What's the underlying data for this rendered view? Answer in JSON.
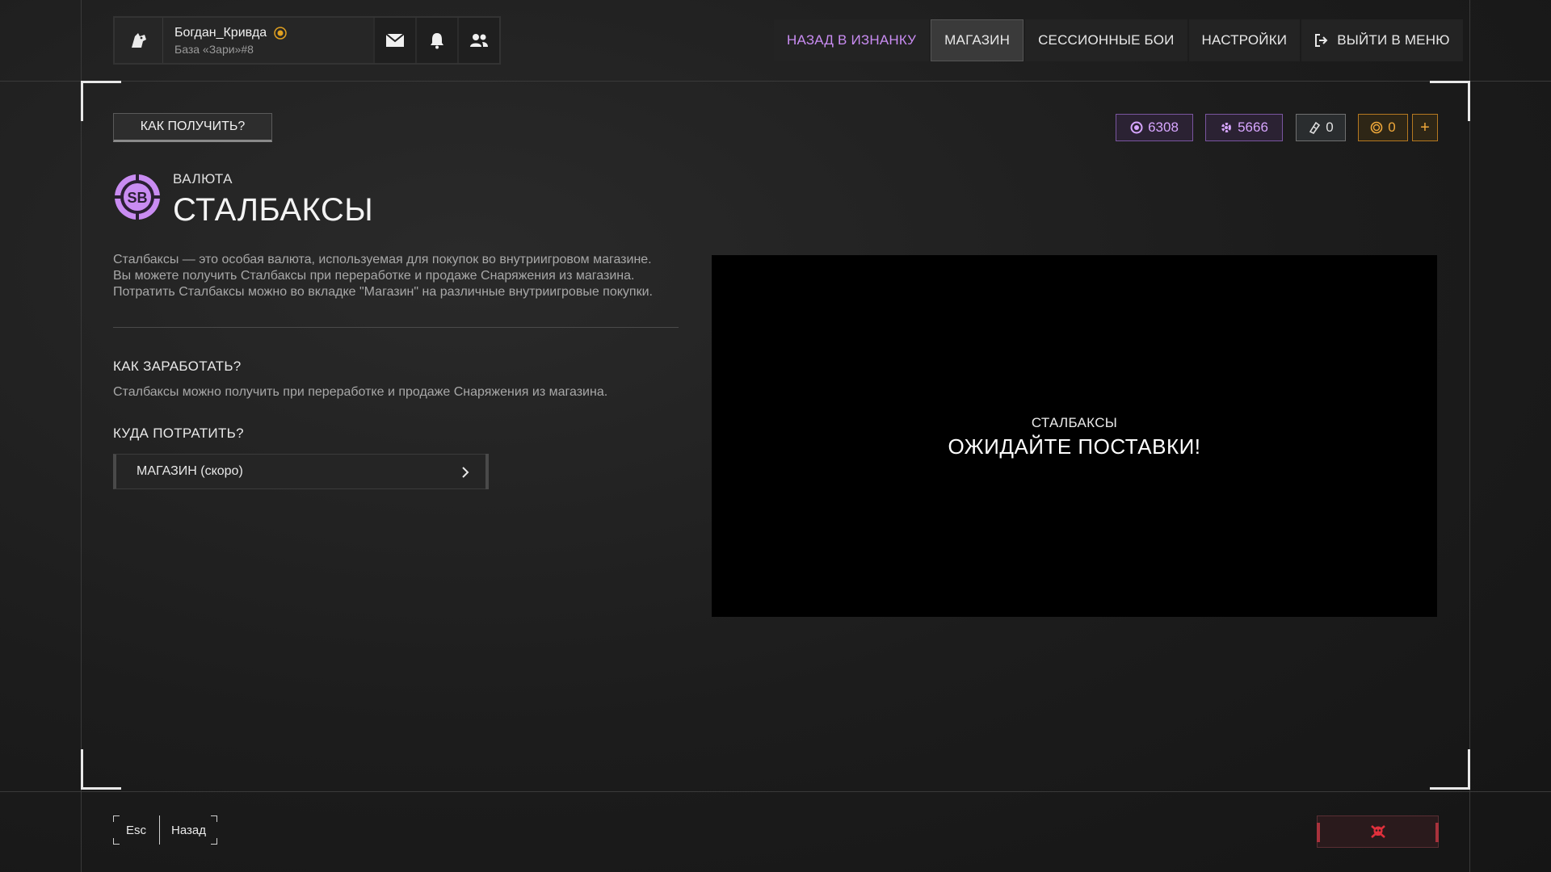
{
  "profile": {
    "username": "Богдан_Кривда",
    "base": "База «Зари»#8"
  },
  "nav": {
    "back_to_inside": "НАЗАД В ИЗНАНКУ",
    "shop": "МАГАЗИН",
    "session_battles": "СЕССИОННЫЕ БОИ",
    "settings": "НАСТРОЙКИ",
    "exit_menu": "ВЫЙТИ В МЕНЮ"
  },
  "how_to_get_label": "КАК ПОЛУЧИТЬ?",
  "currencies": {
    "c1": "6308",
    "c2": "5666",
    "c3": "0",
    "c4": "0",
    "plus": "+"
  },
  "currency": {
    "kicker": "ВАЛЮТА",
    "title": "СТАЛБАКСЫ",
    "coin_text": "SB",
    "desc_1": "Сталбаксы — это особая валюта, используемая для покупок во внутриигровом магазине.",
    "desc_2": "Вы можете получить Сталбаксы при переработке и продаже Снаряжения из магазина.",
    "desc_3": "Потратить Сталбаксы можно во вкладке \"Магазин\" на различные внутриигровые покупки."
  },
  "earn": {
    "heading": "КАК ЗАРАБОТАТЬ?",
    "text": "Сталбаксы можно получить при переработке и продаже Снаряжения из магазина."
  },
  "spend": {
    "heading": "КУДА ПОТРАТИТЬ?",
    "shop_label": "МАГАЗИН (скоро)"
  },
  "panel": {
    "kicker": "СТАЛБАКСЫ",
    "title": "ОЖИДАЙТЕ ПОСТАВКИ!"
  },
  "footer": {
    "esc": "Esc",
    "back": "Назад"
  },
  "colors": {
    "accent_purple": "#c98cf2",
    "accent_orange": "#f0a83a",
    "report_red": "#e0303c"
  },
  "icons": [
    "wolf-icon",
    "badge-icon",
    "mail-icon",
    "bell-icon",
    "friends-icon",
    "exit-icon",
    "coin-icon",
    "gear-currency-icon",
    "ticket-icon",
    "gold-coin-icon",
    "chevron-right-icon",
    "skull-icon"
  ]
}
